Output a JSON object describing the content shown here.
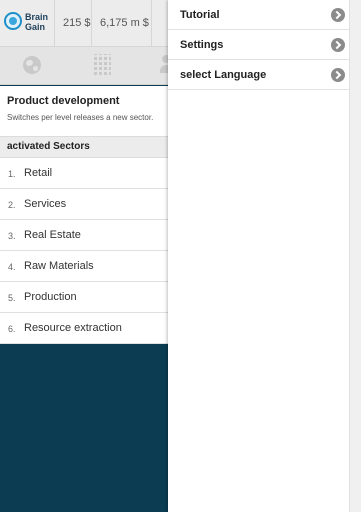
{
  "header": {
    "logo_line1": "Brain",
    "logo_line2": "Gain",
    "money": "215 $",
    "market": "6,175 m $"
  },
  "icons": {
    "tab1": "globe-icon",
    "tab2": "building-icon",
    "tab3": "person-icon"
  },
  "main": {
    "title": "Product development",
    "subtitle": "Switches per level releases a new sector.",
    "sectors_header": "activated Sectors",
    "sectors": [
      {
        "num": "1.",
        "label": "Retail"
      },
      {
        "num": "2.",
        "label": "Services"
      },
      {
        "num": "3.",
        "label": "Real Estate"
      },
      {
        "num": "4.",
        "label": "Raw Materials"
      },
      {
        "num": "5.",
        "label": "Production"
      },
      {
        "num": "6.",
        "label": "Resource extraction"
      }
    ]
  },
  "drawer": {
    "items": [
      {
        "label": "Tutorial"
      },
      {
        "label": "Settings"
      },
      {
        "label": "select Language"
      }
    ]
  },
  "colors": {
    "background": "#0b3c52",
    "accent": "#1f8fc7",
    "chevron": "#8b8b8b"
  }
}
